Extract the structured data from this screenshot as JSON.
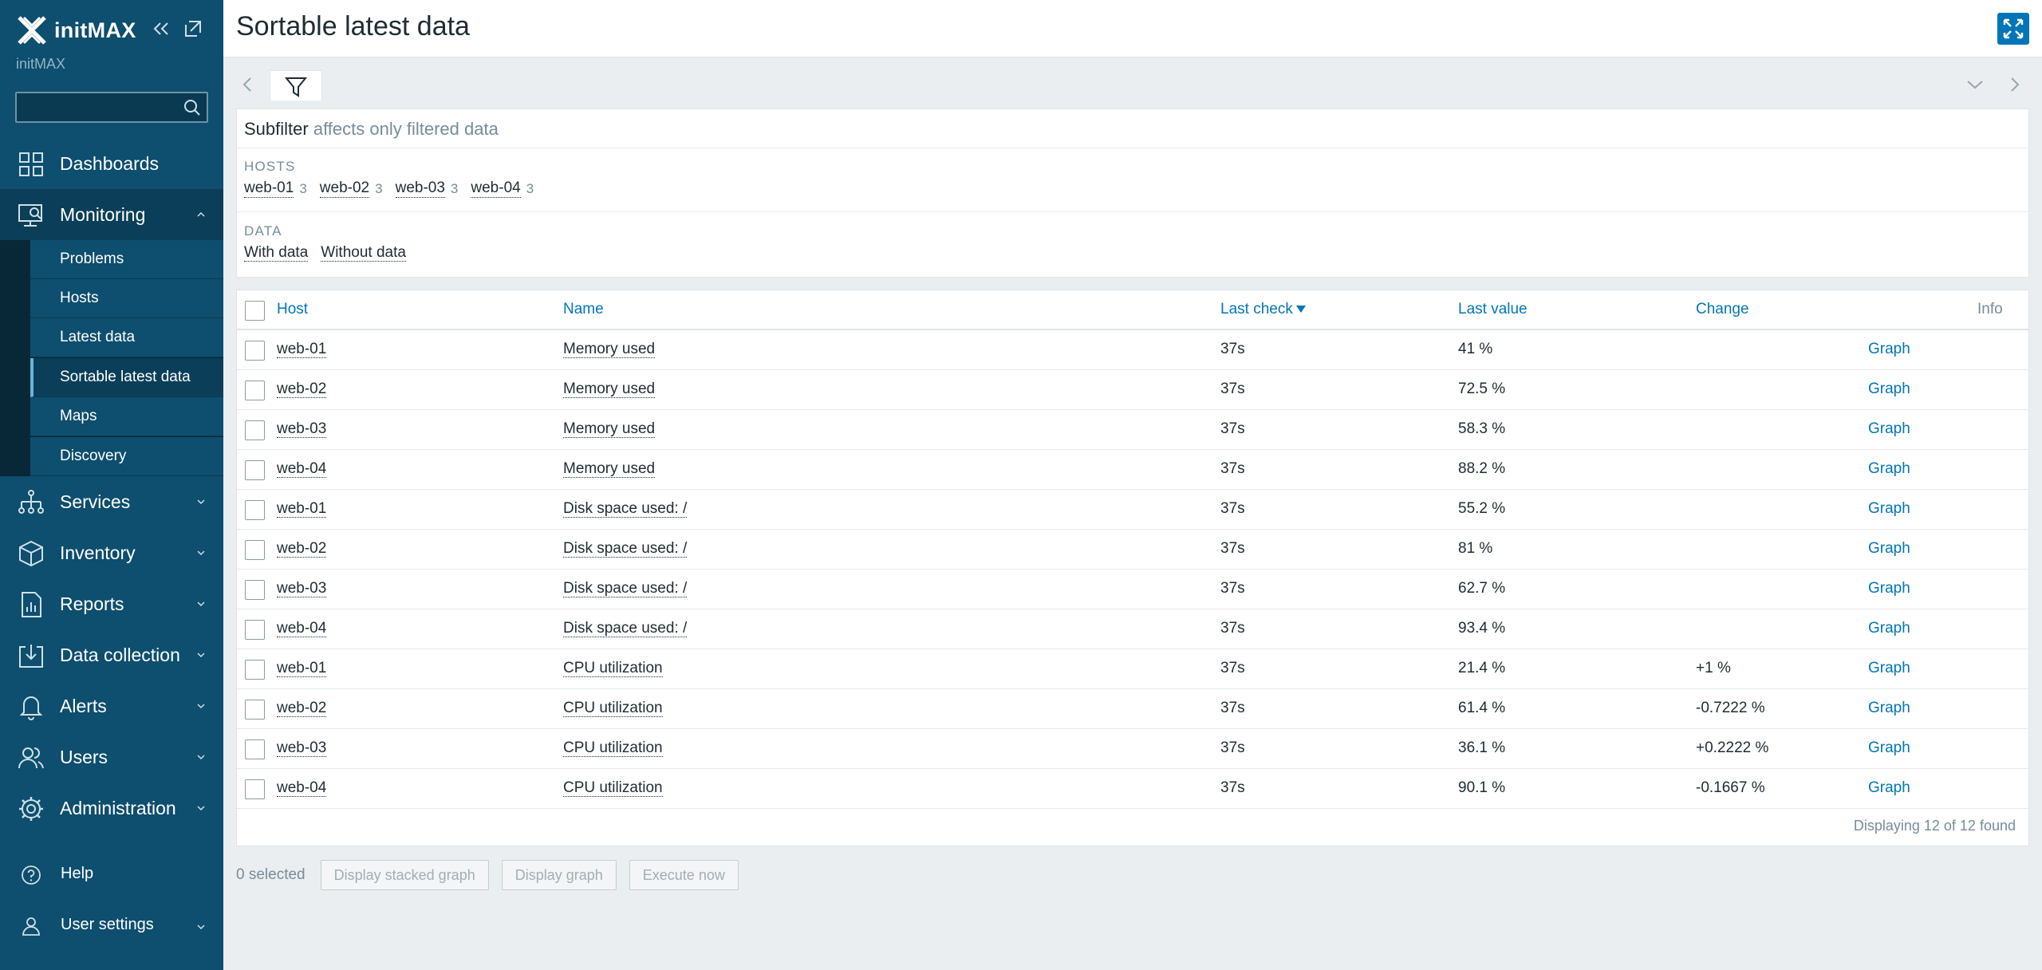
{
  "sidebar": {
    "logo": "initMAX",
    "server_name": "initMAX",
    "search": {
      "value": "",
      "placeholder": ""
    },
    "menu": {
      "dashboards": "Dashboards",
      "monitoring": "Monitoring",
      "services": "Services",
      "inventory": "Inventory",
      "reports": "Reports",
      "data_collection": "Data collection",
      "alerts": "Alerts",
      "users": "Users",
      "administration": "Administration"
    },
    "submenu": {
      "problems": "Problems",
      "hosts": "Hosts",
      "latest_data": "Latest data",
      "sortable_latest_data": "Sortable latest data",
      "maps": "Maps",
      "discovery": "Discovery"
    },
    "bottom": {
      "help": "Help",
      "user_settings": "User settings"
    }
  },
  "header": {
    "title": "Sortable latest data"
  },
  "subfilter": {
    "title": "Subfilter",
    "subtitle": "affects only filtered data",
    "hosts_heading": "HOSTS",
    "hosts": [
      {
        "name": "web-01",
        "count": "3"
      },
      {
        "name": "web-02",
        "count": "3"
      },
      {
        "name": "web-03",
        "count": "3"
      },
      {
        "name": "web-04",
        "count": "3"
      }
    ],
    "data_heading": "DATA",
    "data_options": [
      "With data",
      "Without data"
    ]
  },
  "table": {
    "columns": {
      "host": "Host",
      "name": "Name",
      "last_check": "Last check",
      "last_value": "Last value",
      "change": "Change",
      "info": "Info"
    },
    "rows": [
      {
        "host": "web-01",
        "name": "Memory used",
        "last_check": "37s",
        "last_value": "41 %",
        "change": "",
        "graph": "Graph"
      },
      {
        "host": "web-02",
        "name": "Memory used",
        "last_check": "37s",
        "last_value": "72.5 %",
        "change": "",
        "graph": "Graph"
      },
      {
        "host": "web-03",
        "name": "Memory used",
        "last_check": "37s",
        "last_value": "58.3 %",
        "change": "",
        "graph": "Graph"
      },
      {
        "host": "web-04",
        "name": "Memory used",
        "last_check": "37s",
        "last_value": "88.2 %",
        "change": "",
        "graph": "Graph"
      },
      {
        "host": "web-01",
        "name": "Disk space used: /",
        "last_check": "37s",
        "last_value": "55.2 %",
        "change": "",
        "graph": "Graph"
      },
      {
        "host": "web-02",
        "name": "Disk space used: /",
        "last_check": "37s",
        "last_value": "81 %",
        "change": "",
        "graph": "Graph"
      },
      {
        "host": "web-03",
        "name": "Disk space used: /",
        "last_check": "37s",
        "last_value": "62.7 %",
        "change": "",
        "graph": "Graph"
      },
      {
        "host": "web-04",
        "name": "Disk space used: /",
        "last_check": "37s",
        "last_value": "93.4 %",
        "change": "",
        "graph": "Graph"
      },
      {
        "host": "web-01",
        "name": "CPU utilization",
        "last_check": "37s",
        "last_value": "21.4 %",
        "change": "+1 %",
        "graph": "Graph"
      },
      {
        "host": "web-02",
        "name": "CPU utilization",
        "last_check": "37s",
        "last_value": "61.4 %",
        "change": "-0.7222 %",
        "graph": "Graph"
      },
      {
        "host": "web-03",
        "name": "CPU utilization",
        "last_check": "37s",
        "last_value": "36.1 %",
        "change": "+0.2222 %",
        "graph": "Graph"
      },
      {
        "host": "web-04",
        "name": "CPU utilization",
        "last_check": "37s",
        "last_value": "90.1 %",
        "change": "-0.1667 %",
        "graph": "Graph"
      }
    ],
    "footer": "Displaying 12 of 12 found"
  },
  "actions": {
    "selected": "0 selected",
    "stacked_graph": "Display stacked graph",
    "graph": "Display graph",
    "execute": "Execute now"
  },
  "colors": {
    "sidebar": "#0e4e6e",
    "accent": "#0275b8",
    "background": "#ebeef0"
  }
}
